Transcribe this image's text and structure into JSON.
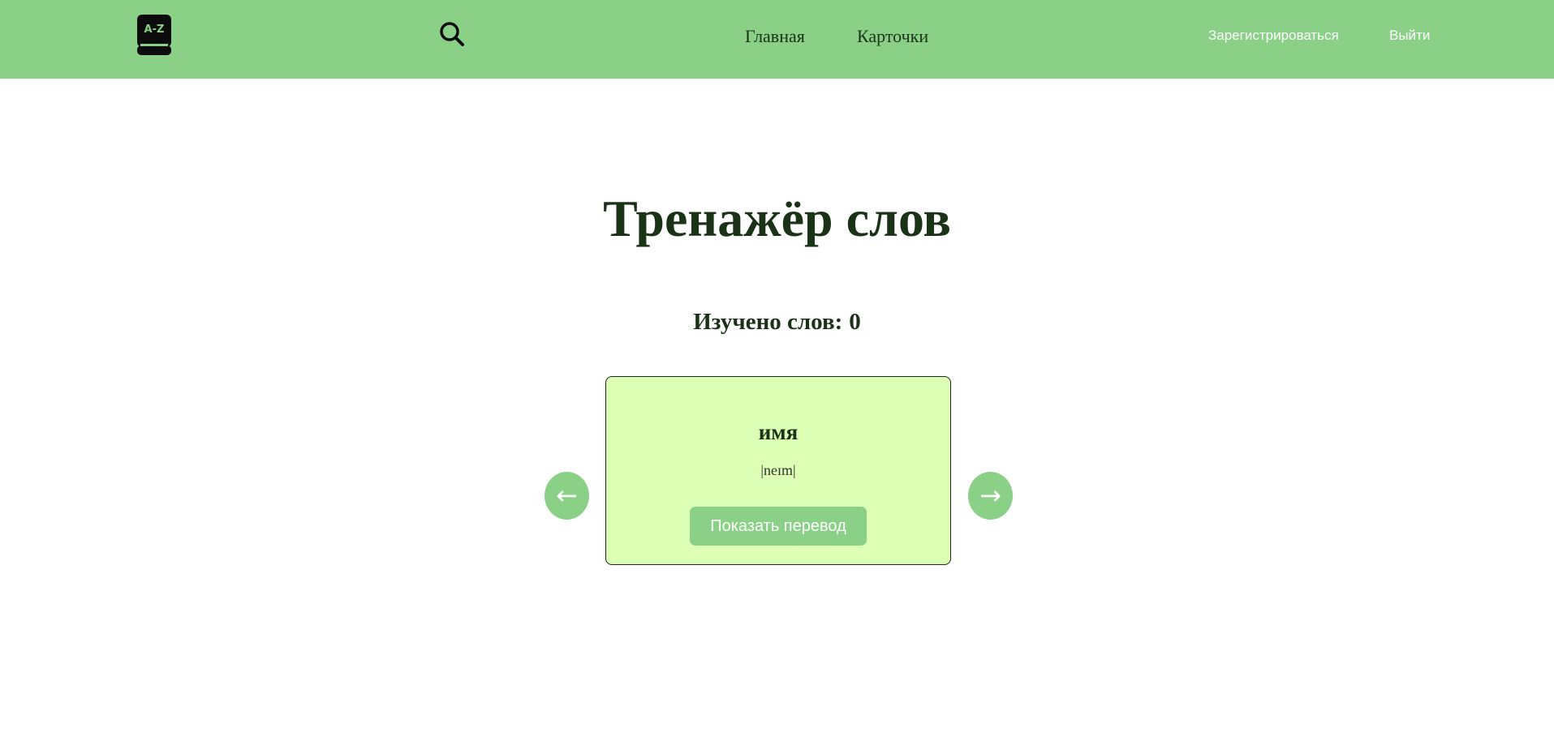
{
  "header": {
    "logo_text": "A-Z",
    "logo_icon": "dictionary-book-icon",
    "search_icon": "search-icon",
    "nav": [
      {
        "label": "Главная"
      },
      {
        "label": "Карточки"
      }
    ],
    "auth": {
      "register_label": "Зарегистрироваться",
      "logout_label": "Выйти"
    }
  },
  "main": {
    "title": "Тренажёр слов",
    "learned_label": "Изучено слов:",
    "learned_count": "0",
    "prev_label": "←",
    "next_label": "→",
    "card": {
      "word": "имя",
      "transcription": "|neɪm|",
      "show_translation_label": "Показать перевод"
    }
  },
  "colors": {
    "header_bg": "#8ad087",
    "accent": "#8ad087",
    "card_bg": "#ddfeb5",
    "text_dark": "#1a3317"
  }
}
